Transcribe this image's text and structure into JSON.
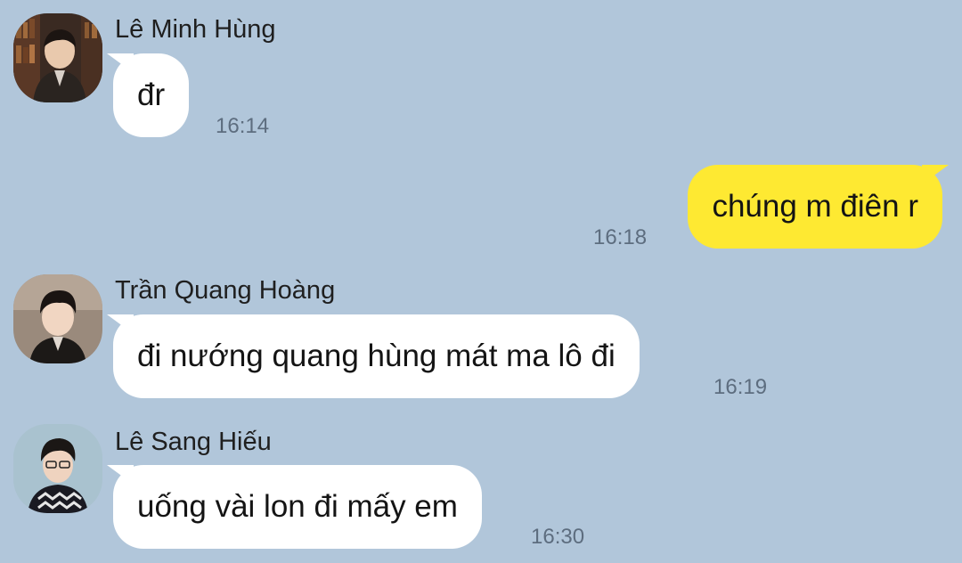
{
  "theme": {
    "background": "#b1c6da",
    "incoming_bubble": "#ffffff",
    "outgoing_bubble": "#fee932",
    "timestamp_color": "#5d6d7f"
  },
  "messages": [
    {
      "direction": "incoming",
      "sender": "Lê Minh Hùng",
      "text": "đr",
      "time": "16:14",
      "avatar_icon": "profile-photo-avatar"
    },
    {
      "direction": "outgoing",
      "text": "chúng m điên r",
      "time": "16:18"
    },
    {
      "direction": "incoming",
      "sender": "Trần Quang Hoàng",
      "text": "đi nướng quang hùng mát ma lô đi",
      "time": "16:19",
      "avatar_icon": "profile-photo-avatar"
    },
    {
      "direction": "incoming",
      "sender": "Lê Sang Hiếu",
      "text": "uống vài lon đi mấy em",
      "time": "16:30",
      "avatar_icon": "profile-photo-avatar"
    }
  ]
}
